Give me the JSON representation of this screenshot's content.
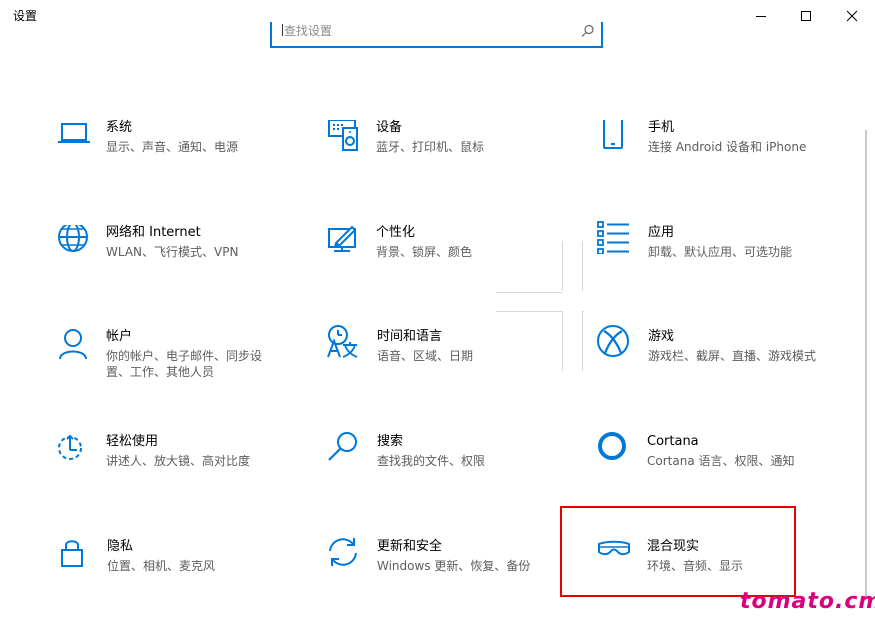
{
  "window": {
    "title": "设置"
  },
  "search": {
    "placeholder": "查找设置"
  },
  "accent_color": "#0078d7",
  "tiles": [
    {
      "title": "系统",
      "desc": "显示、声音、通知、电源",
      "icon": "laptop-icon"
    },
    {
      "title": "设备",
      "desc": "蓝牙、打印机、鼠标",
      "icon": "devices-icon"
    },
    {
      "title": "手机",
      "desc": "连接 Android 设备和 iPhone",
      "icon": "phone-icon"
    },
    {
      "title": "网络和 Internet",
      "desc": "WLAN、飞行模式、VPN",
      "icon": "globe-icon"
    },
    {
      "title": "个性化",
      "desc": "背景、锁屏、颜色",
      "icon": "personalization-icon"
    },
    {
      "title": "应用",
      "desc": "卸载、默认应用、可选功能",
      "icon": "apps-list-icon"
    },
    {
      "title": "帐户",
      "desc": "你的帐户、电子邮件、同步设置、工作、其他人员",
      "icon": "person-icon"
    },
    {
      "title": "时间和语言",
      "desc": "语音、区域、日期",
      "icon": "time-language-icon"
    },
    {
      "title": "游戏",
      "desc": "游戏栏、截屏、直播、游戏模式",
      "icon": "xbox-icon"
    },
    {
      "title": "轻松使用",
      "desc": "讲述人、放大镜、高对比度",
      "icon": "ease-of-access-icon"
    },
    {
      "title": "搜索",
      "desc": "查找我的文件、权限",
      "icon": "search-magnifier-icon"
    },
    {
      "title": "Cortana",
      "desc": "Cortana 语言、权限、通知",
      "icon": "cortana-ring-icon"
    },
    {
      "title": "隐私",
      "desc": "位置、相机、麦克风",
      "icon": "lock-icon"
    },
    {
      "title": "更新和安全",
      "desc": "Windows 更新、恢复、备份",
      "icon": "sync-arrows-icon"
    },
    {
      "title": "混合现实",
      "desc": "环境、音频、显示",
      "icon": "mixed-reality-headset-icon"
    }
  ],
  "watermark": "tomato.cm"
}
